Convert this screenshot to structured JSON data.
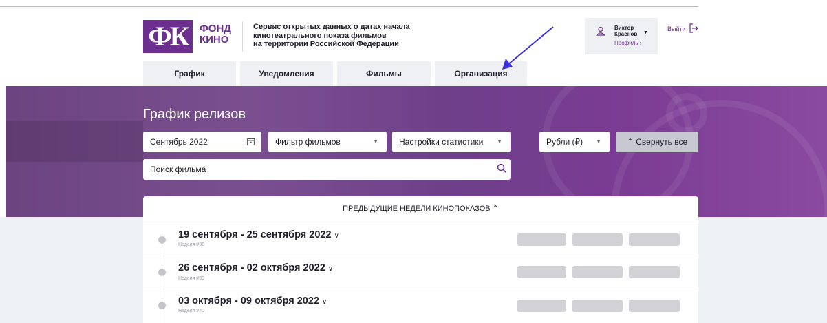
{
  "logo": {
    "mark": "ФК",
    "line1": "ФОНД",
    "line2": "КИНО"
  },
  "service": {
    "line1": "Сервис открытых данных о датах начала",
    "line2": "кинотеатрального показа фильмов",
    "line3": "на территории Российской Федерации"
  },
  "user": {
    "first_name": "Виктор",
    "last_name": "Краснов",
    "profile_link": "Профиль ›",
    "logout": "Выйти"
  },
  "tabs": [
    {
      "label": "График"
    },
    {
      "label": "Уведомления"
    },
    {
      "label": "Фильмы"
    },
    {
      "label": "Организация"
    }
  ],
  "page": {
    "title": "График релизов"
  },
  "filters": {
    "date": "Сентябрь 2022",
    "film_filter": "Фильтр фильмов",
    "stats_settings": "Настройки статистики",
    "currency": "Рубли (₽)",
    "collapse_all": "⌃ Свернуть все",
    "search_placeholder": "Поиск фильма"
  },
  "previous_weeks": "ПРЕДЫДУЩИЕ НЕДЕЛИ КИНОПОКАЗОВ  ⌃",
  "weeks": [
    {
      "range": "19 сентября - 25 сентября 2022",
      "number": "Неделя #38"
    },
    {
      "range": "26 сентября - 02 октября 2022",
      "number": "Неделя #39"
    },
    {
      "range": "03 октября - 09 октября 2022",
      "number": "Неделя #40"
    }
  ],
  "colors": {
    "brand": "#6d2f8f",
    "annotation_arrow": "#3b2fd6"
  }
}
